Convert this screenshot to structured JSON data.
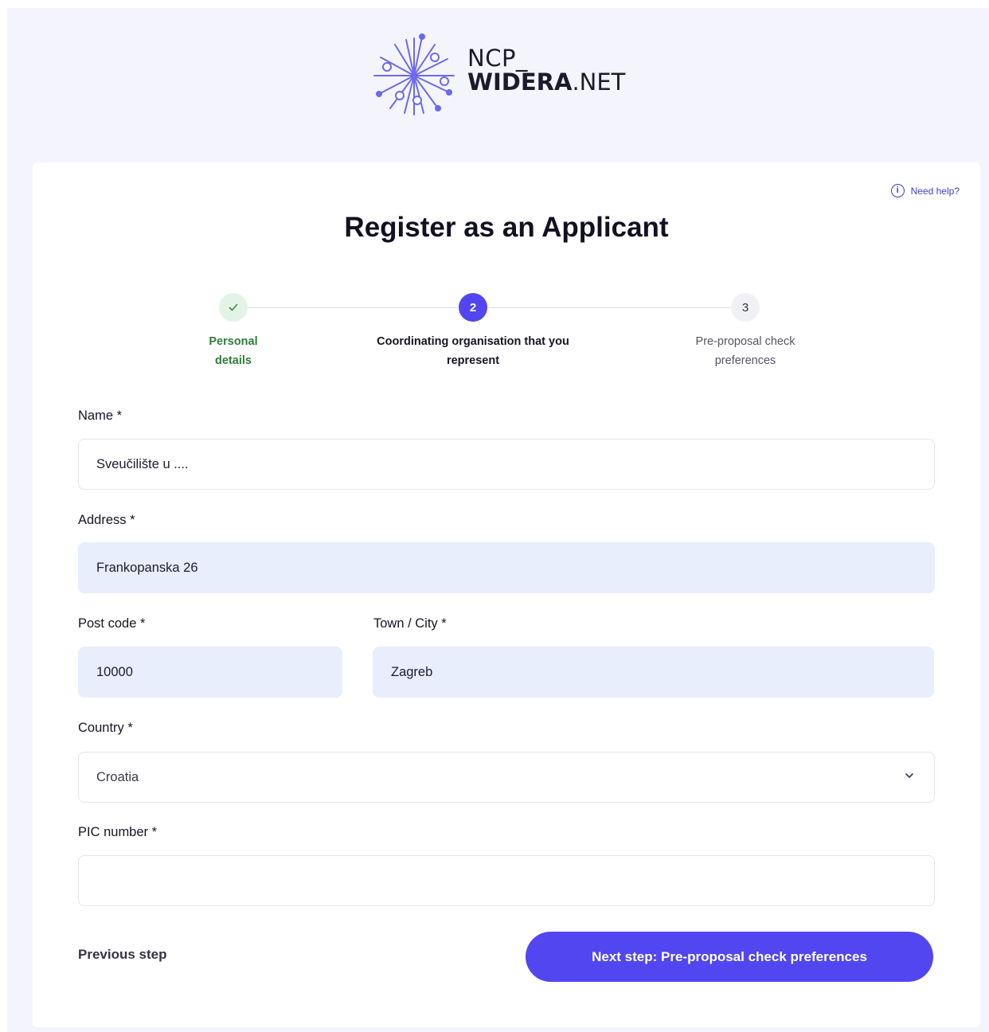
{
  "logo": {
    "line1": "NCP_",
    "line2_bold": "WIDERA",
    "line2_rest": ".NET"
  },
  "help": {
    "label": "Need help?"
  },
  "title": "Register as an Applicant",
  "steps": [
    {
      "number": "1",
      "label_line1": "Personal",
      "label_line2": "details",
      "state": "completed"
    },
    {
      "number": "2",
      "label_line1": "Coordinating organisation that you",
      "label_line2": "represent",
      "state": "active"
    },
    {
      "number": "3",
      "label_line1": "Pre-proposal check",
      "label_line2": "preferences",
      "state": "upcoming"
    }
  ],
  "form": {
    "name": {
      "label": "Name *",
      "value": "Sveučilište u ...."
    },
    "address": {
      "label": "Address *",
      "value": "Frankopanska 26"
    },
    "post_code": {
      "label": "Post code *",
      "value": "10000"
    },
    "town": {
      "label": "Town / City *",
      "value": "Zagreb"
    },
    "country": {
      "label": "Country *",
      "value": "Croatia"
    },
    "pic": {
      "label": "PIC number *",
      "value": ""
    }
  },
  "actions": {
    "previous": "Previous step",
    "next": "Next step: Pre-proposal check preferences"
  },
  "colors": {
    "accent": "#5146f0",
    "completed": "#2f7d3c",
    "filled_input": "#e8eefc"
  }
}
